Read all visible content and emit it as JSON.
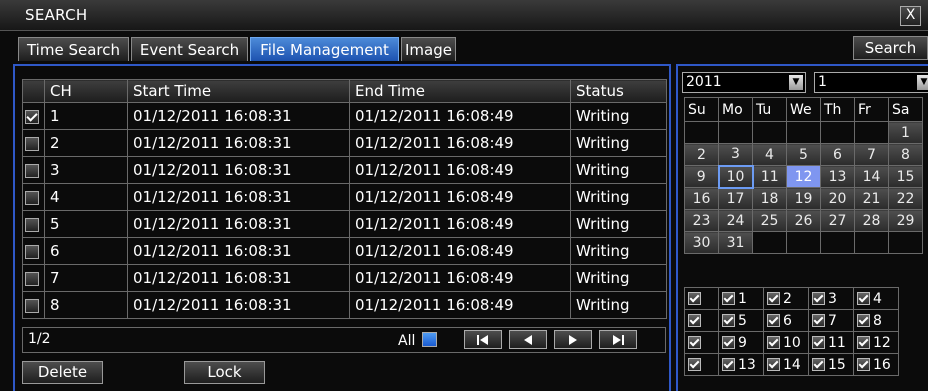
{
  "window": {
    "title": "SEARCH",
    "close_label": "X"
  },
  "tabs": [
    {
      "label": "Time Search",
      "active": false
    },
    {
      "label": "Event Search",
      "active": false
    },
    {
      "label": "File Management",
      "active": true
    },
    {
      "label": "Image",
      "active": false
    }
  ],
  "search_button": "Search",
  "file_list": {
    "headers": {
      "ch": "CH",
      "start": "Start Time",
      "end": "End Time",
      "status": "Status"
    },
    "rows": [
      {
        "ch": "1",
        "start": "01/12/2011 16:08:31",
        "end": "01/12/2011 16:08:49",
        "status": "Writing",
        "checked": true
      },
      {
        "ch": "2",
        "start": "01/12/2011 16:08:31",
        "end": "01/12/2011 16:08:49",
        "status": "Writing",
        "checked": false
      },
      {
        "ch": "3",
        "start": "01/12/2011 16:08:31",
        "end": "01/12/2011 16:08:49",
        "status": "Writing",
        "checked": false
      },
      {
        "ch": "4",
        "start": "01/12/2011 16:08:31",
        "end": "01/12/2011 16:08:49",
        "status": "Writing",
        "checked": false
      },
      {
        "ch": "5",
        "start": "01/12/2011 16:08:31",
        "end": "01/12/2011 16:08:49",
        "status": "Writing",
        "checked": false
      },
      {
        "ch": "6",
        "start": "01/12/2011 16:08:31",
        "end": "01/12/2011 16:08:49",
        "status": "Writing",
        "checked": false
      },
      {
        "ch": "7",
        "start": "01/12/2011 16:08:31",
        "end": "01/12/2011 16:08:49",
        "status": "Writing",
        "checked": false
      },
      {
        "ch": "8",
        "start": "01/12/2011 16:08:31",
        "end": "01/12/2011 16:08:49",
        "status": "Writing",
        "checked": false
      }
    ],
    "page_info": "1/2",
    "all_label": "All",
    "nav_icons": [
      "first-page-icon",
      "prev-page-icon",
      "next-page-icon",
      "last-page-icon"
    ]
  },
  "actions": {
    "delete": "Delete",
    "lock": "Lock"
  },
  "calendar": {
    "year": "2011",
    "month": "1",
    "weekdays": [
      "Su",
      "Mo",
      "Tu",
      "We",
      "Th",
      "Fr",
      "Sa"
    ],
    "weeks": [
      [
        "",
        "",
        "",
        "",
        "",
        "",
        "1"
      ],
      [
        "2",
        "3",
        "4",
        "5",
        "6",
        "7",
        "8"
      ],
      [
        "9",
        "10",
        "11",
        "12",
        "13",
        "14",
        "15"
      ],
      [
        "16",
        "17",
        "18",
        "19",
        "20",
        "21",
        "22"
      ],
      [
        "23",
        "24",
        "25",
        "26",
        "27",
        "28",
        "29"
      ],
      [
        "30",
        "31",
        "",
        "",
        "",
        "",
        ""
      ]
    ],
    "record_day": "10",
    "selected_day": "12"
  },
  "channels": {
    "rows": [
      [
        "1",
        "2",
        "3",
        "4"
      ],
      [
        "5",
        "6",
        "7",
        "8"
      ],
      [
        "9",
        "10",
        "11",
        "12"
      ],
      [
        "13",
        "14",
        "15",
        "16"
      ]
    ]
  },
  "colors": {
    "accent": "#2f58c8",
    "active_tab": "#3a78d0",
    "selected_day": "#7f96f0",
    "background": "#0b0b0b"
  }
}
